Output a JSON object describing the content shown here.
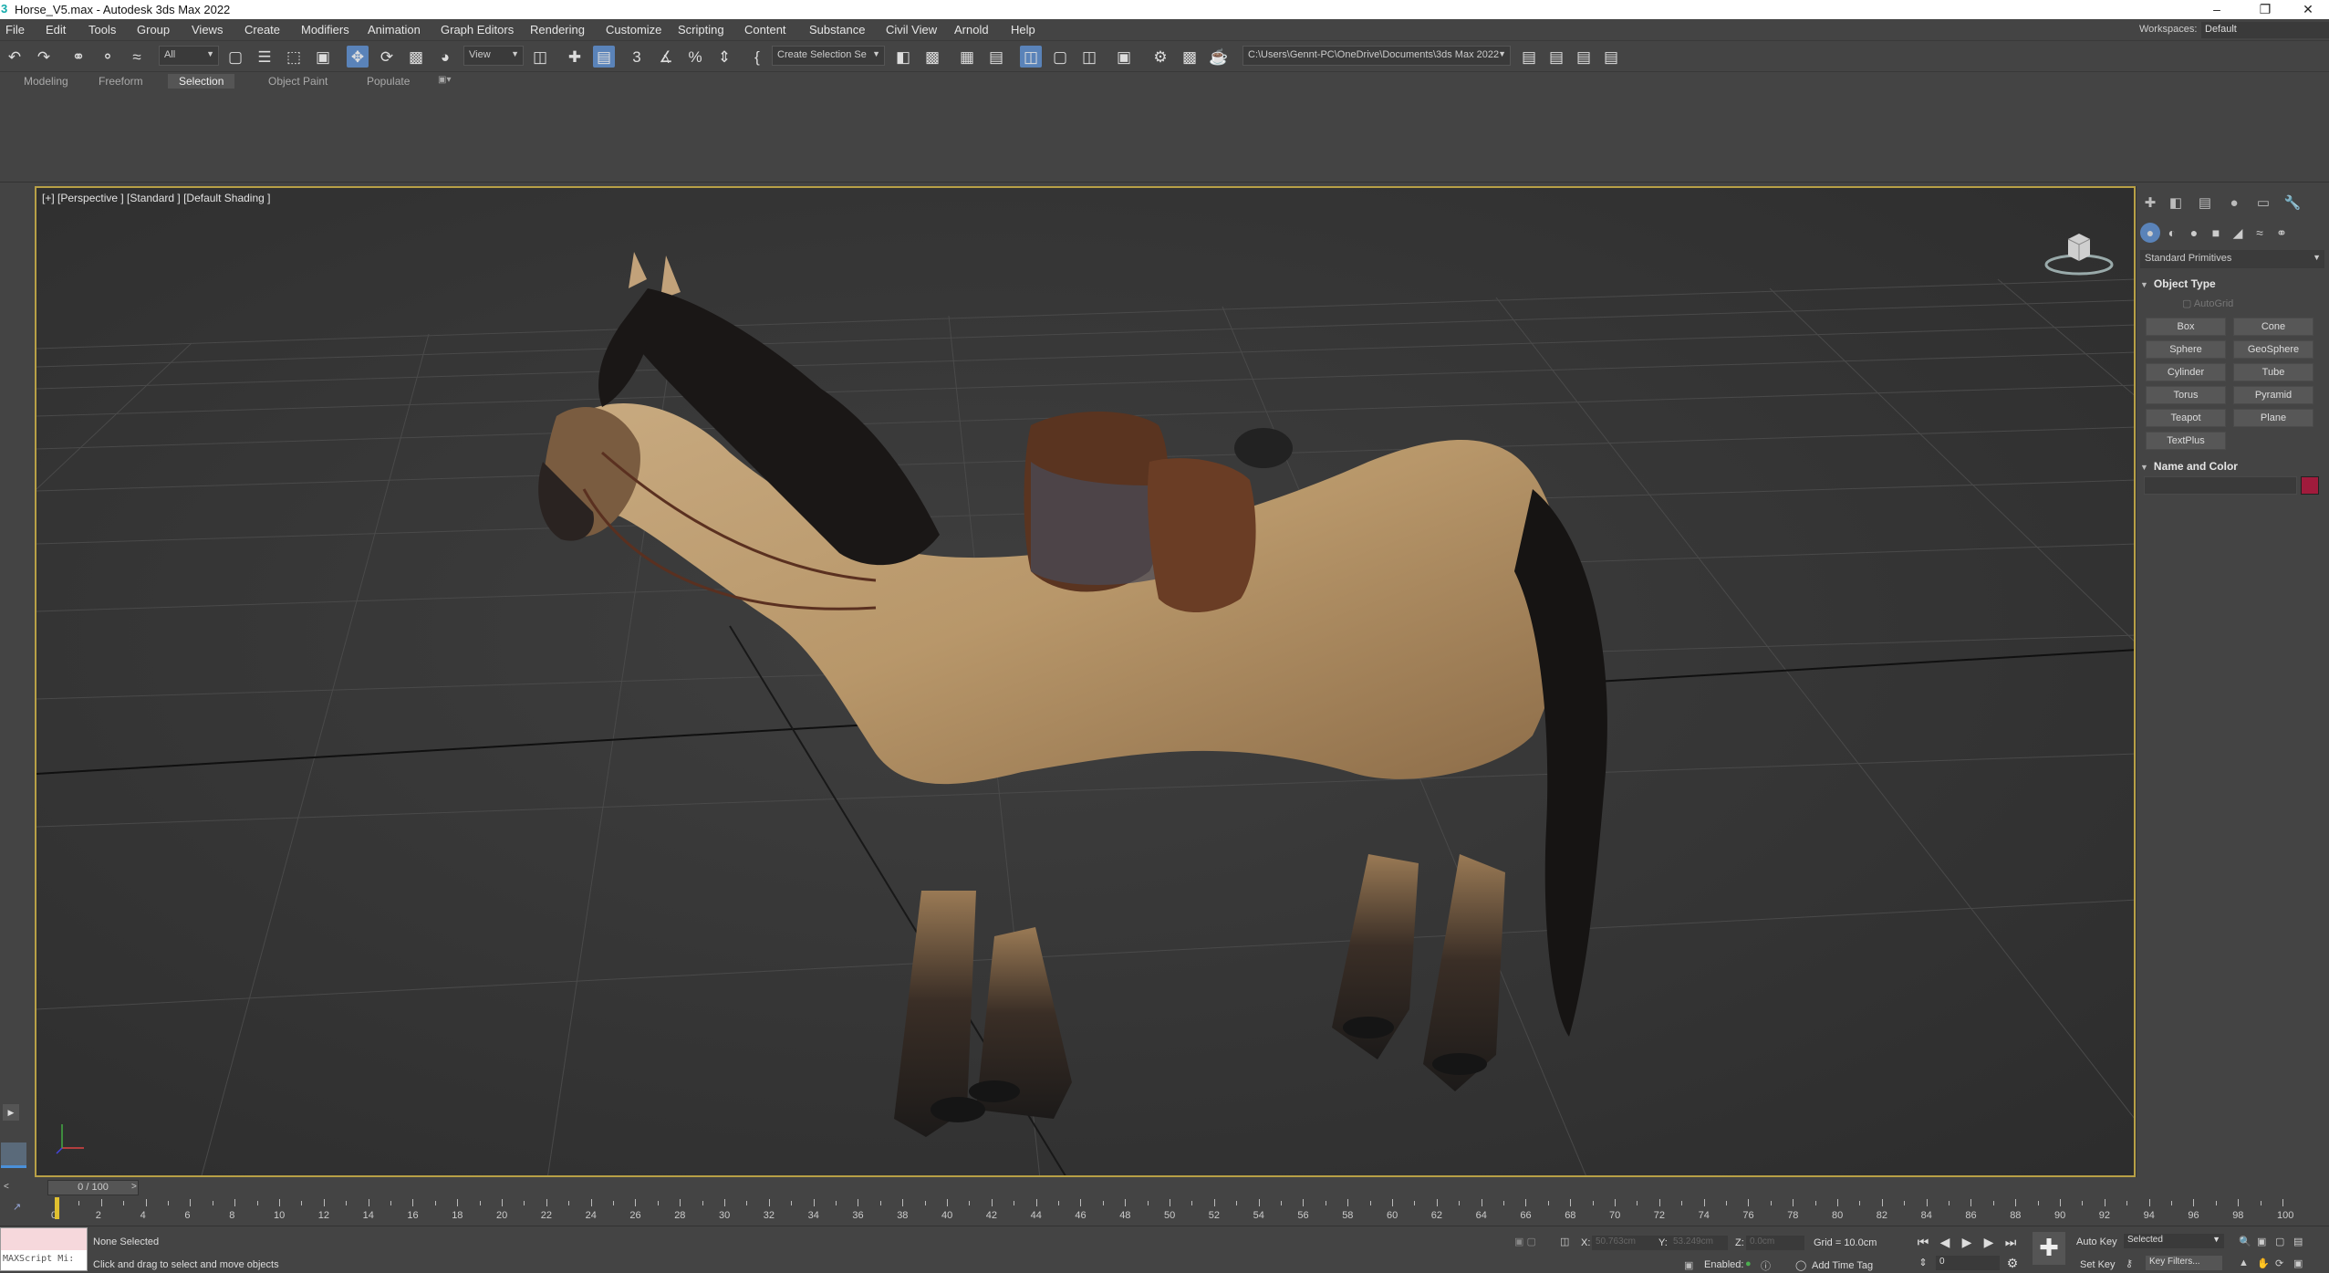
{
  "window": {
    "title": "Horse_V5.max - Autodesk 3ds Max 2022"
  },
  "menu": [
    "File",
    "Edit",
    "Tools",
    "Group",
    "Views",
    "Create",
    "Modifiers",
    "Animation",
    "Graph Editors",
    "Rendering",
    "Customize",
    "Scripting",
    "Content",
    "Substance",
    "Civil View",
    "Arnold",
    "Help"
  ],
  "workspace": {
    "label": "Workspaces:",
    "value": "Default"
  },
  "toolbar": {
    "selection_filter": "All",
    "ref_coord": "View",
    "named_selection": "Create Selection Se",
    "project_path": "C:\\Users\\Gennt-PC\\OneDrive\\Documents\\3ds Max 2022"
  },
  "ribbon_tabs": [
    {
      "label": "Modeling",
      "selected": false
    },
    {
      "label": "Freeform",
      "selected": false
    },
    {
      "label": "Selection",
      "selected": true
    },
    {
      "label": "Object Paint",
      "selected": false
    },
    {
      "label": "Populate",
      "selected": false
    }
  ],
  "viewport": {
    "label": "[+] [Perspective ] [Standard ] [Default Shading ]"
  },
  "command_panel": {
    "category": "Standard Primitives",
    "object_type_title": "Object Type",
    "autogrid": "AutoGrid",
    "buttons": [
      "Box",
      "Cone",
      "Sphere",
      "GeoSphere",
      "Cylinder",
      "Tube",
      "Torus",
      "Pyramid",
      "Teapot",
      "Plane",
      "TextPlus"
    ],
    "name_color_title": "Name and Color",
    "object_color": "#a01b3c"
  },
  "timeline": {
    "frame_label": "0 / 100",
    "ticks": [
      "0",
      "2",
      "4",
      "6",
      "8",
      "10",
      "12",
      "14",
      "16",
      "18",
      "20",
      "22",
      "24",
      "26",
      "28",
      "30",
      "32",
      "34",
      "36",
      "38",
      "40",
      "42",
      "44",
      "46",
      "48",
      "50",
      "52",
      "54",
      "56",
      "58",
      "60",
      "62",
      "64",
      "66",
      "68",
      "70",
      "72",
      "74",
      "76",
      "78",
      "80",
      "82",
      "84",
      "86",
      "88",
      "90",
      "92",
      "94",
      "96",
      "98",
      "100"
    ]
  },
  "status": {
    "maxscript": "MAXScript Mi:",
    "selection": "None Selected",
    "prompt": "Click and drag to select and move objects",
    "x_label": "X:",
    "x_val": "50.763cm",
    "y_label": "Y:",
    "y_val": "53.249cm",
    "z_label": "Z:",
    "z_val": "0.0cm",
    "grid": "Grid = 10.0cm",
    "enabled": "Enabled:",
    "add_time_tag": "Add Time Tag",
    "auto_key": "Auto Key",
    "selected": "Selected",
    "set_key": "Set Key",
    "key_filters": "Key Filters...",
    "frame": "0"
  }
}
